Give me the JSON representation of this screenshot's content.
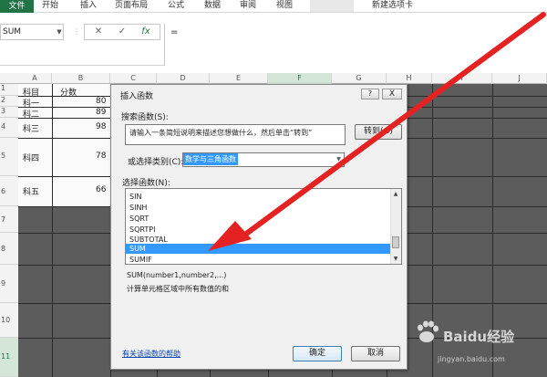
{
  "ribbon": {
    "tabs": [
      "文件",
      "开始",
      "插入",
      "页面布局",
      "公式",
      "数据",
      "审阅",
      "视图",
      "新建选项卡"
    ]
  },
  "formula_bar": {
    "name_box": "SUM",
    "cancel_symbol": "✕",
    "enter_symbol": "✓",
    "fx_symbol": "fx",
    "content": "="
  },
  "grid": {
    "columns": [
      "A",
      "B",
      "C",
      "D",
      "E",
      "F",
      "G",
      "H",
      "I",
      "J"
    ],
    "rows": [
      {
        "num": "1",
        "a": "科目",
        "b": "分数"
      },
      {
        "num": "2",
        "a": "科一",
        "b": "80"
      },
      {
        "num": "3",
        "a": "科二",
        "b": "89"
      },
      {
        "num": "4",
        "a": "科三",
        "b": "98"
      },
      {
        "num": "5",
        "a": "科四",
        "b": "78"
      },
      {
        "num": "6",
        "a": "科五",
        "b": "66"
      },
      {
        "num": "7"
      },
      {
        "num": "8"
      },
      {
        "num": "9"
      },
      {
        "num": "10"
      },
      {
        "num": "11"
      }
    ]
  },
  "dialog": {
    "title": "插入函数",
    "help_label": "?",
    "close_label": "X",
    "search_label": "搜索函数(S):",
    "search_placeholder": "请输入一条简短说明来描述您想做什么，然后单击“转到”",
    "goto_label": "转到(G)",
    "category_label": "或选择类别(C):",
    "category_value": "数学与三角函数",
    "function_list_label": "选择函数(N):",
    "functions": [
      "SIN",
      "SINH",
      "SQRT",
      "SQRTPI",
      "SUBTOTAL",
      "SUM",
      "SUMIF"
    ],
    "selected_function": "SUM",
    "syntax": "SUM(number1,number2,...)",
    "description": "计算单元格区域中所有数值的和",
    "help_link": "有关该函数的帮助",
    "ok_label": "确定",
    "cancel_label": "取消"
  },
  "watermark": {
    "brand": "Baidu经验",
    "url": "jingyan.baidu.com"
  },
  "colors": {
    "excel_green": "#217346",
    "selection_blue": "#3399ff",
    "arrow_red": "#e52222"
  }
}
